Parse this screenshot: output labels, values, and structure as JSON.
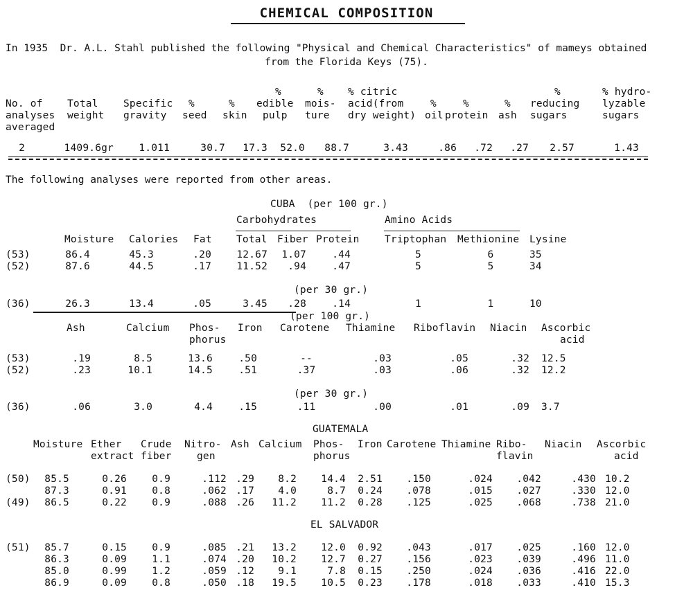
{
  "document": {
    "title": "CHEMICAL COMPOSITION",
    "intro_line1": "In 1935  Dr. A.L. Stahl published the following \"Physical and Chemical Characteristics\" of mameys obtained",
    "intro_line2": "from the Florida Keys (75).",
    "other_areas_note": "The following analyses were reported from other areas."
  },
  "florida_table": {
    "headers": [
      {
        "lines": [
          "",
          "No. of",
          "analyses",
          "averaged"
        ]
      },
      {
        "lines": [
          "",
          "Total",
          "weight",
          ""
        ]
      },
      {
        "lines": [
          "",
          "Specific",
          "gravity",
          ""
        ]
      },
      {
        "lines": [
          "",
          "%",
          "seed",
          ""
        ]
      },
      {
        "lines": [
          "",
          "%",
          "skin",
          ""
        ]
      },
      {
        "lines": [
          "%",
          "edible",
          "pulp",
          ""
        ]
      },
      {
        "lines": [
          "%",
          "mois-",
          "ture",
          ""
        ]
      },
      {
        "lines": [
          "% citric",
          "acid(from",
          "dry weight)",
          ""
        ]
      },
      {
        "lines": [
          "",
          "%",
          "oil",
          ""
        ]
      },
      {
        "lines": [
          "",
          "%",
          "protein",
          ""
        ]
      },
      {
        "lines": [
          "",
          "%",
          "ash",
          ""
        ]
      },
      {
        "lines": [
          "%",
          "reducing",
          "sugars",
          ""
        ]
      },
      {
        "lines": [
          "% hydro-",
          "lyzable",
          "sugars",
          ""
        ]
      }
    ],
    "row": [
      "2",
      "1409.6gr",
      "1.011",
      "30.7",
      "17.3",
      "52.0",
      "88.7",
      "3.43",
      ".86",
      ".72",
      ".27",
      "2.57",
      "1.43"
    ]
  },
  "cuba": {
    "section_title": "CUBA  (per 100 gr.)",
    "group_carbohydrates": "Carbohydrates",
    "group_amino_acids": "Amino Acids",
    "per_30_gr": "(per 30 gr.)",
    "per_100_gr": "(per 100 gr.)",
    "block1": {
      "headers": [
        "Moisture",
        "Calories",
        "Fat",
        "Total",
        "Fiber",
        "Protein",
        "Triptophan",
        "Methionine",
        "Lysine"
      ],
      "rows": [
        {
          "ref": "(53)",
          "values": [
            "86.4",
            "45.3",
            ".20",
            "12.67",
            "1.07",
            ".44",
            "5",
            "6",
            "35"
          ]
        },
        {
          "ref": "(52)",
          "values": [
            "87.6",
            "44.5",
            ".17",
            "11.52",
            ".94",
            ".47",
            "5",
            "5",
            "34"
          ]
        },
        {
          "ref": "(36)",
          "values": [
            "26.3",
            "13.4",
            ".05",
            "3.45",
            ".28",
            ".14",
            "1",
            "1",
            "10"
          ]
        }
      ]
    },
    "block2": {
      "headers": [
        {
          "lines": [
            "Ash",
            ""
          ]
        },
        {
          "lines": [
            "Calcium",
            ""
          ]
        },
        {
          "lines": [
            "Phos-",
            "phorus"
          ]
        },
        {
          "lines": [
            "Iron",
            ""
          ]
        },
        {
          "lines": [
            "Carotene",
            ""
          ]
        },
        {
          "lines": [
            "Thiamine",
            ""
          ]
        },
        {
          "lines": [
            "Riboflavin",
            ""
          ]
        },
        {
          "lines": [
            "Niacin",
            ""
          ]
        },
        {
          "lines": [
            "Ascorbic",
            "acid"
          ]
        }
      ],
      "rows": [
        {
          "ref": "(53)",
          "values": [
            ".19",
            "8.5",
            "13.6",
            ".50",
            "--",
            ".03",
            ".05",
            ".32",
            "12.5"
          ]
        },
        {
          "ref": "(52)",
          "values": [
            ".23",
            "10.1",
            "14.5",
            ".51",
            ".37",
            ".03",
            ".06",
            ".32",
            "12.2"
          ]
        },
        {
          "ref": "(36)",
          "values": [
            ".06",
            "3.0",
            "4.4",
            ".15",
            ".11",
            ".00",
            ".01",
            ".09",
            "3.7"
          ]
        }
      ]
    }
  },
  "guatemala": {
    "section_title": "GUATEMALA",
    "headers": [
      {
        "lines": [
          "Moisture",
          ""
        ]
      },
      {
        "lines": [
          "Ether",
          "extract"
        ]
      },
      {
        "lines": [
          "Crude",
          "fiber"
        ]
      },
      {
        "lines": [
          "Nitro-",
          "gen"
        ]
      },
      {
        "lines": [
          "Ash",
          ""
        ]
      },
      {
        "lines": [
          "Calcium",
          ""
        ]
      },
      {
        "lines": [
          "Phos-",
          "phorus"
        ]
      },
      {
        "lines": [
          "Iron",
          ""
        ]
      },
      {
        "lines": [
          "Carotene",
          ""
        ]
      },
      {
        "lines": [
          "Thiamine",
          ""
        ]
      },
      {
        "lines": [
          "Ribo-",
          "flavin"
        ]
      },
      {
        "lines": [
          "Niacin",
          ""
        ]
      },
      {
        "lines": [
          "Ascorbic",
          "acid"
        ]
      }
    ],
    "rows": [
      {
        "ref": "(50)",
        "values": [
          "85.5",
          "0.26",
          "0.9",
          ".112",
          ".29",
          "8.2",
          "14.4",
          "2.51",
          ".150",
          ".024",
          ".042",
          ".430",
          "10.2"
        ]
      },
      {
        "ref": "",
        "values": [
          "87.3",
          "0.91",
          "0.8",
          ".062",
          ".17",
          "4.0",
          "8.7",
          "0.24",
          ".078",
          ".015",
          ".027",
          ".330",
          "12.0"
        ]
      },
      {
        "ref": "(49)",
        "values": [
          "86.5",
          "0.22",
          "0.9",
          ".088",
          ".26",
          "11.2",
          "11.2",
          "0.28",
          ".125",
          ".025",
          ".068",
          ".738",
          "21.0"
        ]
      }
    ]
  },
  "el_salvador": {
    "section_title": "EL SALVADOR",
    "rows": [
      {
        "ref": "(51)",
        "values": [
          "85.7",
          "0.15",
          "0.9",
          ".085",
          ".21",
          "13.2",
          "12.0",
          "0.92",
          ".043",
          ".017",
          ".025",
          ".160",
          "12.0"
        ]
      },
      {
        "ref": "",
        "values": [
          "86.3",
          "0.09",
          "1.1",
          ".074",
          ".20",
          "10.2",
          "12.7",
          "0.27",
          ".156",
          ".023",
          ".039",
          ".496",
          "11.0"
        ]
      },
      {
        "ref": "",
        "values": [
          "85.0",
          "0.99",
          "1.2",
          ".059",
          ".12",
          "9.1",
          "7.8",
          "0.15",
          ".250",
          ".024",
          ".036",
          ".416",
          "22.0"
        ]
      },
      {
        "ref": "",
        "values": [
          "86.9",
          "0.09",
          "0.8",
          ".050",
          ".18",
          "19.5",
          "10.5",
          "0.23",
          ".178",
          ".018",
          ".033",
          ".410",
          "15.3"
        ]
      }
    ]
  }
}
